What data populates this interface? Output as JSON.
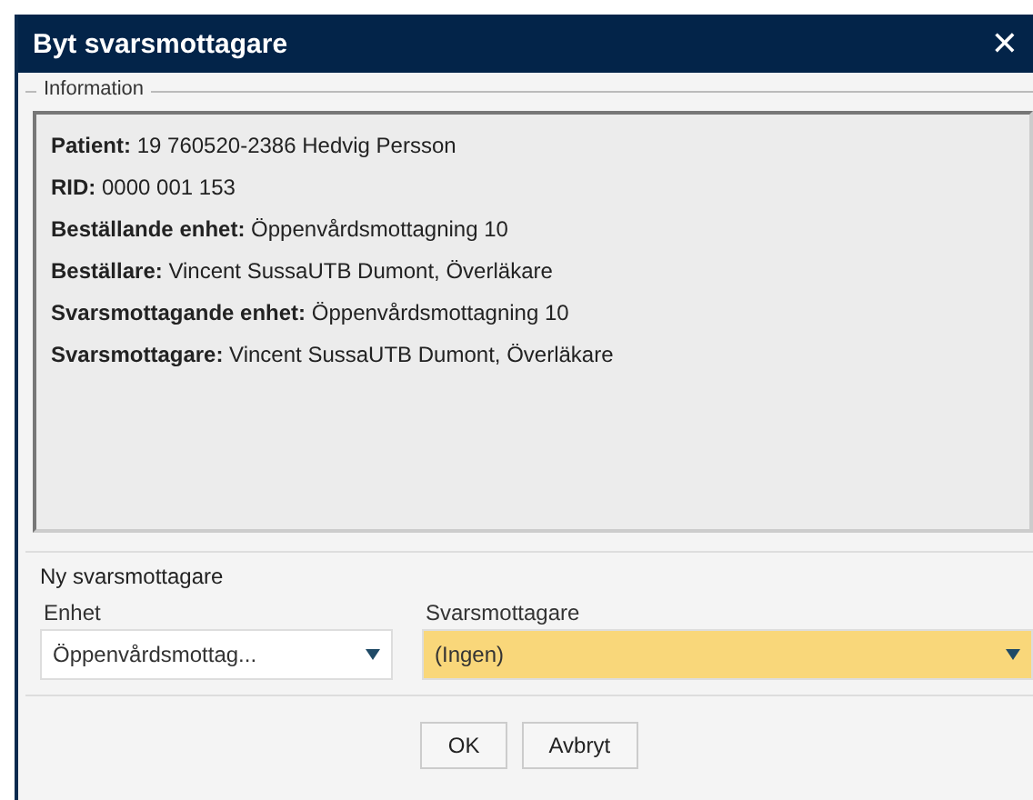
{
  "window": {
    "title": "Byt svarsmottagare",
    "close": "✕"
  },
  "information": {
    "legend": "Information",
    "lines": [
      "**Patient:** 19 760520-2386  Hedvig Persson",
      "**RID:** 0000 001 153",
      "**Beställande enhet:** Öppenvårdsmottagning 10",
      "**Beställare:** Vincent SussaUTB Dumont, Överläkare",
      "**Svarsmottagande enhet:** Öppenvårdsmottagning 10",
      "**Svarsmottagare:** Vincent SussaUTB Dumont, Överläkare"
    ]
  },
  "new_recipient": {
    "legend": "Ny svarsmottagare",
    "fields": [
      {
        "label": "Enhet",
        "value": "Öppenvårdsmottag...",
        "highlighted": false
      },
      {
        "label": "Svarsmottagare",
        "value": "(Ingen)",
        "highlighted": true
      }
    ]
  },
  "buttons": [
    "OK",
    "Avbryt"
  ]
}
